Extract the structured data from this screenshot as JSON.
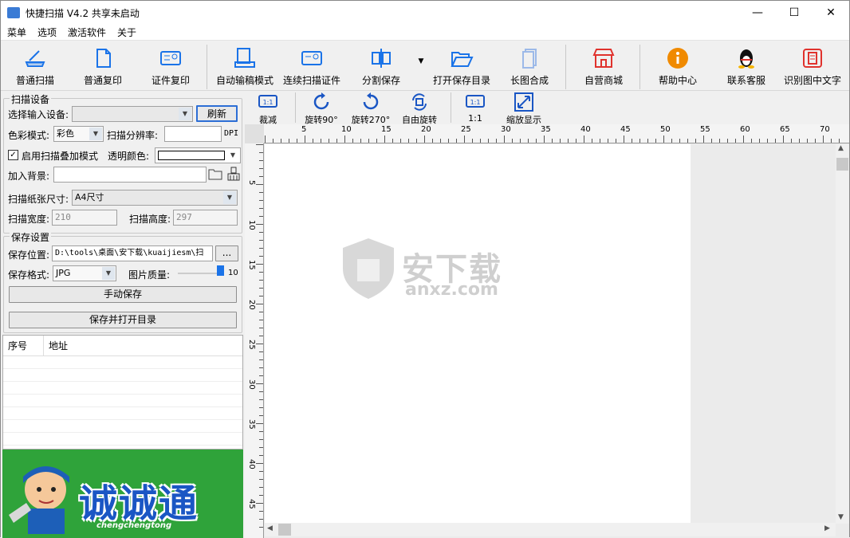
{
  "window": {
    "title": "快捷扫描 V4.2 共享未启动",
    "minimize": "—",
    "maximize": "☐",
    "close": "✕"
  },
  "menu": [
    "菜单",
    "选项",
    "激活软件",
    "关于"
  ],
  "toolbar": {
    "items": [
      {
        "label": "普通扫描",
        "icon": "scanner-icon"
      },
      {
        "label": "普通复印",
        "icon": "copy-icon"
      },
      {
        "label": "证件复印",
        "icon": "id-card-icon"
      },
      {
        "label": "自动输稿模式",
        "icon": "auto-feed-icon"
      },
      {
        "label": "连续扫描证件",
        "icon": "continuous-id-icon"
      },
      {
        "label": "分割保存",
        "icon": "split-save-icon"
      },
      {
        "label": "打开保存目录",
        "icon": "folder-open-icon"
      },
      {
        "label": "长图合成",
        "icon": "long-image-icon"
      },
      {
        "label": "自营商城",
        "icon": "shop-icon"
      },
      {
        "label": "帮助中心",
        "icon": "info-icon"
      },
      {
        "label": "联系客服",
        "icon": "qq-penguin-icon"
      },
      {
        "label": "识别图中文字",
        "icon": "ocr-icon"
      }
    ]
  },
  "scan_settings": {
    "group_title": "扫描设备",
    "input_device_label": "选择输入设备:",
    "input_device_value": "",
    "refresh_label": "刷新",
    "color_mode_label": "色彩模式:",
    "color_mode_value": "彩色",
    "resolution_label": "扫描分辨率:",
    "resolution_value": "",
    "resolution_unit": "DPI",
    "overlay_checkbox_label": "启用扫描叠加模式",
    "overlay_checked": true,
    "transparent_color_label": "透明颜色:",
    "add_background_label": "加入背景:",
    "add_background_value": "",
    "paper_size_label": "扫描纸张尺寸:",
    "paper_size_value": "A4尺寸",
    "width_label": "扫描宽度:",
    "width_value": "210",
    "height_label": "扫描高度:",
    "height_value": "297"
  },
  "save_settings": {
    "group_title": "保存设置",
    "location_label": "保存位置:",
    "location_value": "D:\\tools\\桌面\\安下载\\kuaijiesm\\扫",
    "browse_label": "...",
    "format_label": "保存格式:",
    "format_value": "JPG",
    "quality_label": "图片质量:",
    "quality_value": "10",
    "manual_save_label": "手动保存",
    "save_open_label": "保存并打开目录"
  },
  "list": {
    "columns": [
      "序号",
      "地址"
    ],
    "rows": []
  },
  "banner": {
    "text": "诚诚通",
    "subtext": "chengchengtong"
  },
  "view_toolbar": [
    {
      "label": "裁减",
      "icon": "crop-icon"
    },
    {
      "label": "旋转90°",
      "icon": "rotate-cw-icon"
    },
    {
      "label": "旋转270°",
      "icon": "rotate-ccw-icon"
    },
    {
      "label": "自由旋转",
      "icon": "free-rotate-icon"
    },
    {
      "label": "1:1",
      "icon": "actual-size-icon"
    },
    {
      "label": "缩放显示",
      "icon": "fit-zoom-icon"
    }
  ],
  "ruler": {
    "h_labels": [
      "5",
      "10",
      "15",
      "20",
      "25",
      "30",
      "35",
      "40",
      "45",
      "50",
      "55",
      "60",
      "65",
      "70"
    ],
    "v_labels": [
      "5",
      "10",
      "15",
      "20",
      "25",
      "30",
      "35",
      "40",
      "45"
    ]
  },
  "watermark": {
    "text": "安下载",
    "subtext": "anxz.com"
  },
  "colors": {
    "accent": "#1a73e8",
    "banner_bg": "#2fa33a",
    "help_orange": "#f08a00",
    "shop_red": "#e0322d"
  }
}
